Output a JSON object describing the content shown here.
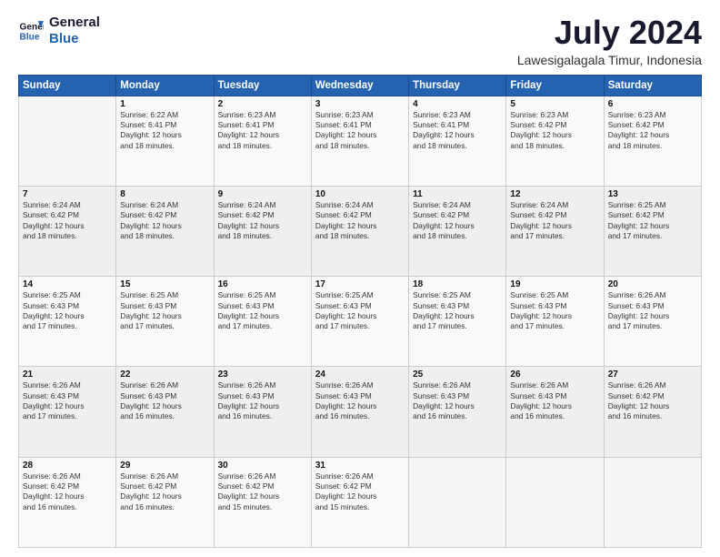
{
  "header": {
    "logo_line1": "General",
    "logo_line2": "Blue",
    "month_year": "July 2024",
    "location": "Lawesigalagala Timur, Indonesia"
  },
  "weekdays": [
    "Sunday",
    "Monday",
    "Tuesday",
    "Wednesday",
    "Thursday",
    "Friday",
    "Saturday"
  ],
  "weeks": [
    [
      {
        "day": "",
        "info": ""
      },
      {
        "day": "1",
        "info": "Sunrise: 6:22 AM\nSunset: 6:41 PM\nDaylight: 12 hours\nand 18 minutes."
      },
      {
        "day": "2",
        "info": "Sunrise: 6:23 AM\nSunset: 6:41 PM\nDaylight: 12 hours\nand 18 minutes."
      },
      {
        "day": "3",
        "info": "Sunrise: 6:23 AM\nSunset: 6:41 PM\nDaylight: 12 hours\nand 18 minutes."
      },
      {
        "day": "4",
        "info": "Sunrise: 6:23 AM\nSunset: 6:41 PM\nDaylight: 12 hours\nand 18 minutes."
      },
      {
        "day": "5",
        "info": "Sunrise: 6:23 AM\nSunset: 6:42 PM\nDaylight: 12 hours\nand 18 minutes."
      },
      {
        "day": "6",
        "info": "Sunrise: 6:23 AM\nSunset: 6:42 PM\nDaylight: 12 hours\nand 18 minutes."
      }
    ],
    [
      {
        "day": "7",
        "info": "Sunrise: 6:24 AM\nSunset: 6:42 PM\nDaylight: 12 hours\nand 18 minutes."
      },
      {
        "day": "8",
        "info": "Sunrise: 6:24 AM\nSunset: 6:42 PM\nDaylight: 12 hours\nand 18 minutes."
      },
      {
        "day": "9",
        "info": "Sunrise: 6:24 AM\nSunset: 6:42 PM\nDaylight: 12 hours\nand 18 minutes."
      },
      {
        "day": "10",
        "info": "Sunrise: 6:24 AM\nSunset: 6:42 PM\nDaylight: 12 hours\nand 18 minutes."
      },
      {
        "day": "11",
        "info": "Sunrise: 6:24 AM\nSunset: 6:42 PM\nDaylight: 12 hours\nand 18 minutes."
      },
      {
        "day": "12",
        "info": "Sunrise: 6:24 AM\nSunset: 6:42 PM\nDaylight: 12 hours\nand 17 minutes."
      },
      {
        "day": "13",
        "info": "Sunrise: 6:25 AM\nSunset: 6:42 PM\nDaylight: 12 hours\nand 17 minutes."
      }
    ],
    [
      {
        "day": "14",
        "info": "Sunrise: 6:25 AM\nSunset: 6:43 PM\nDaylight: 12 hours\nand 17 minutes."
      },
      {
        "day": "15",
        "info": "Sunrise: 6:25 AM\nSunset: 6:43 PM\nDaylight: 12 hours\nand 17 minutes."
      },
      {
        "day": "16",
        "info": "Sunrise: 6:25 AM\nSunset: 6:43 PM\nDaylight: 12 hours\nand 17 minutes."
      },
      {
        "day": "17",
        "info": "Sunrise: 6:25 AM\nSunset: 6:43 PM\nDaylight: 12 hours\nand 17 minutes."
      },
      {
        "day": "18",
        "info": "Sunrise: 6:25 AM\nSunset: 6:43 PM\nDaylight: 12 hours\nand 17 minutes."
      },
      {
        "day": "19",
        "info": "Sunrise: 6:25 AM\nSunset: 6:43 PM\nDaylight: 12 hours\nand 17 minutes."
      },
      {
        "day": "20",
        "info": "Sunrise: 6:26 AM\nSunset: 6:43 PM\nDaylight: 12 hours\nand 17 minutes."
      }
    ],
    [
      {
        "day": "21",
        "info": "Sunrise: 6:26 AM\nSunset: 6:43 PM\nDaylight: 12 hours\nand 17 minutes."
      },
      {
        "day": "22",
        "info": "Sunrise: 6:26 AM\nSunset: 6:43 PM\nDaylight: 12 hours\nand 16 minutes."
      },
      {
        "day": "23",
        "info": "Sunrise: 6:26 AM\nSunset: 6:43 PM\nDaylight: 12 hours\nand 16 minutes."
      },
      {
        "day": "24",
        "info": "Sunrise: 6:26 AM\nSunset: 6:43 PM\nDaylight: 12 hours\nand 16 minutes."
      },
      {
        "day": "25",
        "info": "Sunrise: 6:26 AM\nSunset: 6:43 PM\nDaylight: 12 hours\nand 16 minutes."
      },
      {
        "day": "26",
        "info": "Sunrise: 6:26 AM\nSunset: 6:43 PM\nDaylight: 12 hours\nand 16 minutes."
      },
      {
        "day": "27",
        "info": "Sunrise: 6:26 AM\nSunset: 6:42 PM\nDaylight: 12 hours\nand 16 minutes."
      }
    ],
    [
      {
        "day": "28",
        "info": "Sunrise: 6:26 AM\nSunset: 6:42 PM\nDaylight: 12 hours\nand 16 minutes."
      },
      {
        "day": "29",
        "info": "Sunrise: 6:26 AM\nSunset: 6:42 PM\nDaylight: 12 hours\nand 16 minutes."
      },
      {
        "day": "30",
        "info": "Sunrise: 6:26 AM\nSunset: 6:42 PM\nDaylight: 12 hours\nand 15 minutes."
      },
      {
        "day": "31",
        "info": "Sunrise: 6:26 AM\nSunset: 6:42 PM\nDaylight: 12 hours\nand 15 minutes."
      },
      {
        "day": "",
        "info": ""
      },
      {
        "day": "",
        "info": ""
      },
      {
        "day": "",
        "info": ""
      }
    ]
  ]
}
